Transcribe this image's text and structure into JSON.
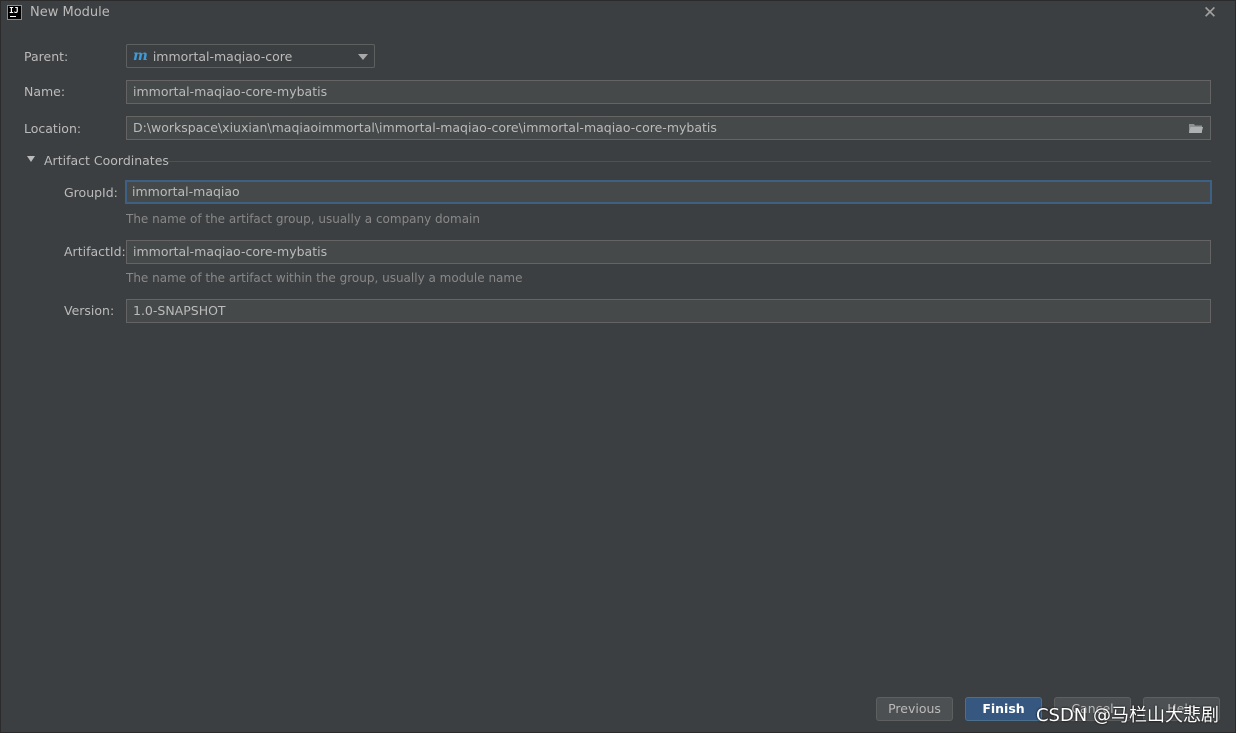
{
  "window": {
    "title": "New Module",
    "app_icon_text": "IJ"
  },
  "form": {
    "parent_label": "Parent:",
    "parent_value": "immortal-maqiao-core",
    "parent_icon": "m",
    "name_label": "Name:",
    "name_value": "immortal-maqiao-core-mybatis",
    "location_label": "Location:",
    "location_value": "D:\\workspace\\xiuxian\\maqiaoimmortal\\immortal-maqiao-core\\immortal-maqiao-core-mybatis"
  },
  "artifact": {
    "section_title": "Artifact Coordinates",
    "groupid_label": "GroupId:",
    "groupid_value": "immortal-maqiao",
    "groupid_hint": "The name of the artifact group, usually a company domain",
    "artifactid_label": "ArtifactId:",
    "artifactid_value": "immortal-maqiao-core-mybatis",
    "artifactid_hint": "The name of the artifact within the group, usually a module name",
    "version_label": "Version:",
    "version_value": "1.0-SNAPSHOT"
  },
  "buttons": {
    "previous": "Previous",
    "finish": "Finish",
    "cancel": "Cancel",
    "help": "Help"
  },
  "watermark": "CSDN @马栏山大悲剧",
  "colors": {
    "background": "#3c3f41",
    "field_bg": "#45494a",
    "focus_border": "#3d6185",
    "primary_button": "#365880",
    "maven_blue": "#3e9bd8"
  },
  "icons": {
    "close": "close-icon",
    "folder": "folder-icon",
    "dropdown": "chevron-down-icon",
    "section": "triangle-down-icon"
  }
}
